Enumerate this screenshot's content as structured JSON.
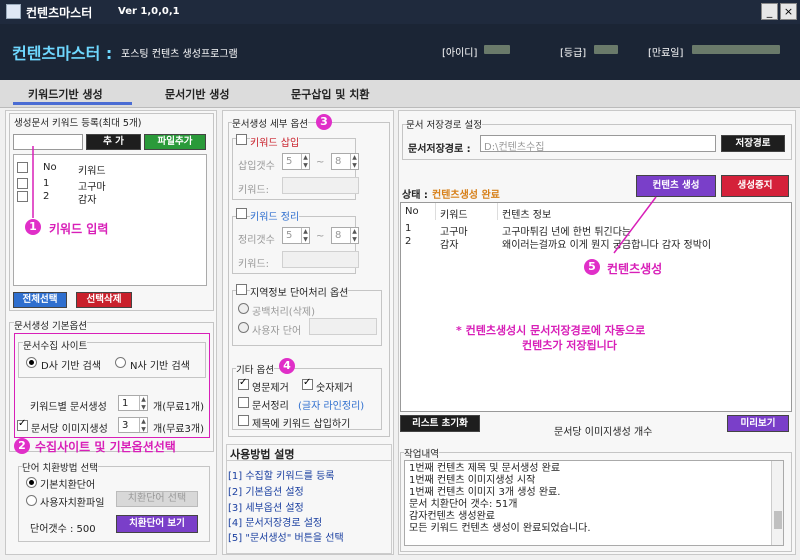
{
  "app": {
    "title": "컨텐츠마스터",
    "version": "Ver 1,0,0,1",
    "brand": "컨텐츠마스터 :",
    "subtitle": "포스팅 컨텐츠 생성프로그램",
    "id_label": "[아이디]",
    "grade_label": "[등급]",
    "expire_label": "[만료일]",
    "minimize": "_",
    "close": "×"
  },
  "tabs": [
    "키워드기반 생성",
    "문서기반 생성",
    "문구삽입 및 치환"
  ],
  "keyword": {
    "group_title": "생성문서 키워드 등록(최대 5개)",
    "add_label": "추 가",
    "file_add_label": "파일추가",
    "col_no": "No",
    "col_keyword": "키워드",
    "rows": [
      {
        "no": "1",
        "keyword": "고구마"
      },
      {
        "no": "2",
        "keyword": "감자"
      }
    ],
    "select_all": "전체선택",
    "delete_selected": "선택삭제",
    "annotation": "키워드 입력",
    "ann_num": "1"
  },
  "basic": {
    "group_title": "문서생성 기본옵션",
    "site_group": "문서수집 사이트",
    "site_d": "D사 기반 검색",
    "site_n": "N사 기반 검색",
    "per_keyword_label": "키워드별 문서생성",
    "per_keyword_value": "1",
    "per_keyword_unit": "개(무료1개)",
    "image_chk": "문서당 이미지생성",
    "image_value": "3",
    "image_unit": "개(무료3개)",
    "annotation": "수집사이트 및 기본옵션선택",
    "ann_num": "2"
  },
  "replace": {
    "group_title": "단어 치환방법 선택",
    "opt_basic": "기본치환단어",
    "opt_user": "사용자치환파일",
    "file_btn": "치환단어 선택",
    "count_label": "단어갯수 : 500",
    "view_btn": "치환단어 보기"
  },
  "detail": {
    "group_title": "문서생성 세부 옵션",
    "ann_num": "3",
    "kw_insert": "키워드 삽입",
    "insert_count": "삽입갯수",
    "insert_from": "5",
    "insert_to": "8",
    "tilde": "~",
    "kw_label": "키워드:",
    "kw_arrange": "키워드 정리",
    "arrange_count": "정리갯수",
    "arrange_from": "5",
    "arrange_to": "8",
    "kw_label2": "키워드:",
    "region_title": "지역정보 단어처리 옵션",
    "region_space": "공백처리(삭제)",
    "region_user": "사용자 단어"
  },
  "etc": {
    "group_title": "기타 옵션",
    "ann_num": "4",
    "remove_en": "영문제거",
    "remove_num": "숫자제거",
    "doc_arrange": "문서정리",
    "doc_arrange_note": "(글자 라인정리)",
    "title_kw": "제목에 키워드 삽입하기"
  },
  "howto": {
    "title": "사용방법 설명",
    "items": [
      "[1] 수집할 키워드를 등록",
      "[2] 기본옵션 설정",
      "[3] 세부옵션 설정",
      "[4] 문서저장경로 설정",
      "[5] \"문서생성\" 버튼을 선택"
    ]
  },
  "save": {
    "group_title": "문서 저장경로 설정",
    "path_label": "문서저장경로 :",
    "path_value": "D:\\컨텐츠수집",
    "path_btn": "저장경로"
  },
  "status": {
    "label": "상태 :",
    "value": "컨텐츠생성 완료",
    "create_btn": "컨텐츠 생성",
    "stop_btn": "생성중지",
    "col_no": "No",
    "col_keyword": "키워드",
    "col_info": "컨텐츠 정보",
    "rows": [
      {
        "no": "1",
        "keyword": "고구마",
        "info": "고구마튀김  년에 한번 튀긴다는"
      },
      {
        "no": "2",
        "keyword": "감자",
        "info": "왜이러는걸까요 이게 뭔지 궁금합니다 감자 정박이"
      }
    ],
    "annotation": "컨텐츠생성",
    "ann_num": "5",
    "note_line1": "* 컨텐츠생성시 문서저장경로에 자동으로",
    "note_line2": "컨텐츠가 저장됩니다",
    "list_reset": "리스트 초기화",
    "image_count_label": "문서당 이미지생성 개수",
    "preview": "미리보기"
  },
  "log": {
    "title": "작업내역",
    "lines": [
      "1번째 컨텐츠 제목 및 문서생성 완료",
      "1번째 컨텐츠 이미지생성 시작",
      "1번째 컨텐츠 이미지 3개 생성 완료.",
      "문서 치환단어 갯수: 51개",
      "감자컨텐츠 생성완료",
      "모든 키워드 컨텐츠 생성이 완료되었습니다."
    ]
  },
  "colors": {
    "header_bg": "#1b2535",
    "brand": "#6fd8ff",
    "annotation": "#d81fb8",
    "add_btn": "#1e1e1e",
    "file_btn": "#2a9a3a",
    "select_btn": "#2f6fcf",
    "delete_btn": "#c9202b",
    "purple_btn": "#7a3fc9",
    "stop_btn": "#d4213a"
  }
}
